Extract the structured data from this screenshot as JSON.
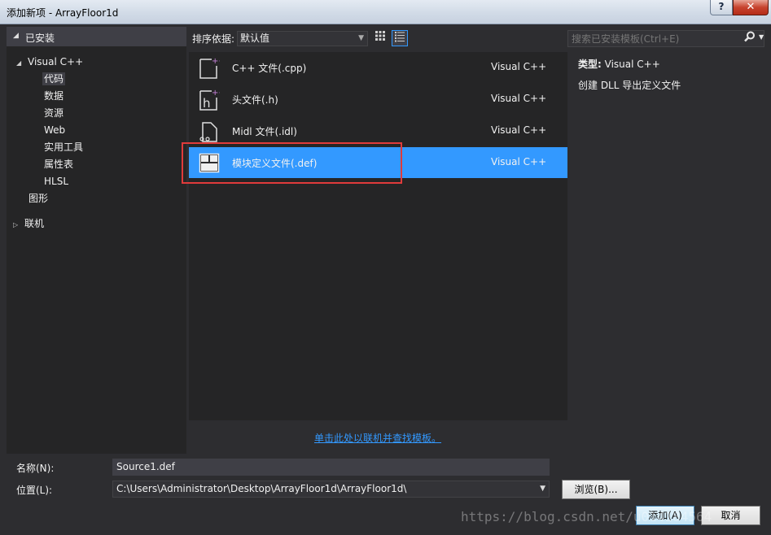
{
  "window": {
    "title": "添加新项 - ArrayFloor1d",
    "help_label": "?",
    "close_label": "✕"
  },
  "left_panel": {
    "header": "已安装",
    "tree": [
      {
        "label": "Visual C++",
        "expanded": true
      },
      {
        "label": "代码",
        "selected": true
      },
      {
        "label": "数据"
      },
      {
        "label": "资源"
      },
      {
        "label": "Web"
      },
      {
        "label": "实用工具"
      },
      {
        "label": "属性表"
      },
      {
        "label": "HLSL"
      },
      {
        "label": "图形"
      },
      {
        "label": "联机",
        "expanded": false
      }
    ]
  },
  "toolbar": {
    "sort_label": "排序依据:",
    "sort_value": "默认值",
    "grid_view_icon": "grid-view-icon",
    "list_view_icon": "list-view-icon"
  },
  "search": {
    "placeholder": "搜索已安装模板(Ctrl+E)"
  },
  "templates": [
    {
      "name": "C++ 文件(.cpp)",
      "lang": "Visual C++",
      "icon": "cpp-file-icon"
    },
    {
      "name": "头文件(.h)",
      "lang": "Visual C++",
      "icon": "header-file-icon"
    },
    {
      "name": "Midl 文件(.idl)",
      "lang": "Visual C++",
      "icon": "midl-file-icon"
    },
    {
      "name": "模块定义文件(.def)",
      "lang": "Visual C++",
      "icon": "def-file-icon",
      "selected": true
    }
  ],
  "details": {
    "type_key": "类型:",
    "type_value": "Visual C++",
    "description": "创建 DLL 导出定义文件"
  },
  "online_link": "单击此处以联机并查找模板。",
  "form": {
    "name_label": "名称(N):",
    "name_value": "Source1.def",
    "location_label": "位置(L):",
    "location_value": "C:\\Users\\Administrator\\Desktop\\ArrayFloor1d\\ArrayFloor1d\\",
    "browse_label": "浏览(B)...",
    "add_label": "添加(A)",
    "cancel_label": "取消"
  },
  "watermark": "https://blog.csdn.net/u014184564",
  "colors": {
    "background": "#2d2d30",
    "panel": "#252526",
    "selection": "#3399ff",
    "highlight_box": "#e03b3b",
    "link": "#3399ff"
  }
}
